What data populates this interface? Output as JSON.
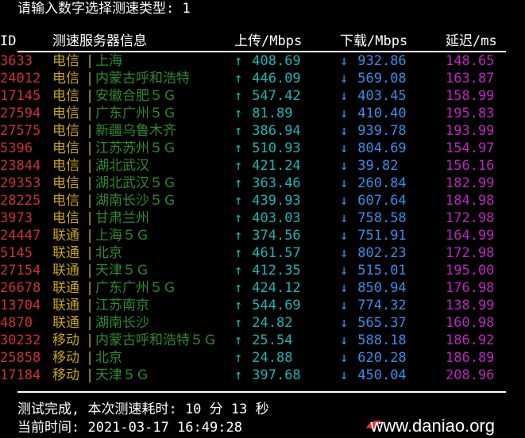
{
  "prompt": "请输入数字选择测速类型: 1",
  "header": {
    "id": "ID",
    "server": "测速服务器信息",
    "up": "上传/Mbps",
    "down": "下载/Mbps",
    "latency": "延迟/ms"
  },
  "up_arrow": "↑",
  "down_arrow": "↓",
  "bar": "|",
  "rows": [
    {
      "id": "3633",
      "isp": "电信",
      "city": "上海",
      "up": "408.69",
      "down": "932.86",
      "latency": "148.65"
    },
    {
      "id": "24012",
      "isp": "电信",
      "city": "内蒙古呼和浩特",
      "up": "446.09",
      "down": "569.08",
      "latency": "163.87"
    },
    {
      "id": "17145",
      "isp": "电信",
      "city": "安徽合肥５Ｇ",
      "up": "547.42",
      "down": "403.45",
      "latency": "158.99"
    },
    {
      "id": "27594",
      "isp": "电信",
      "city": "广东广州５Ｇ",
      "up": "81.89",
      "down": "410.40",
      "latency": "195.83"
    },
    {
      "id": "27575",
      "isp": "电信",
      "city": "新疆乌鲁木齐",
      "up": "386.94",
      "down": "939.78",
      "latency": "193.99"
    },
    {
      "id": "5396",
      "isp": "电信",
      "city": "江苏苏州５Ｇ",
      "up": "510.93",
      "down": "804.69",
      "latency": "154.97"
    },
    {
      "id": "23844",
      "isp": "电信",
      "city": "湖北武汉",
      "up": "421.24",
      "down": "39.82",
      "latency": "156.16"
    },
    {
      "id": "29353",
      "isp": "电信",
      "city": "湖北武汉５Ｇ",
      "up": "363.46",
      "down": "260.84",
      "latency": "182.99"
    },
    {
      "id": "28225",
      "isp": "电信",
      "city": "湖南长沙５Ｇ",
      "up": "439.93",
      "down": "607.64",
      "latency": "184.98"
    },
    {
      "id": "3973",
      "isp": "电信",
      "city": "甘肃兰州",
      "up": "403.03",
      "down": "758.58",
      "latency": "172.98"
    },
    {
      "id": "24447",
      "isp": "联通",
      "city": "上海５Ｇ",
      "up": "374.56",
      "down": "751.91",
      "latency": "164.99"
    },
    {
      "id": "5145",
      "isp": "联通",
      "city": "北京",
      "up": "461.57",
      "down": "802.23",
      "latency": "172.98"
    },
    {
      "id": "27154",
      "isp": "联通",
      "city": "天津５Ｇ",
      "up": "412.35",
      "down": "515.01",
      "latency": "195.00"
    },
    {
      "id": "26678",
      "isp": "联通",
      "city": "广东广州５Ｇ",
      "up": "424.12",
      "down": "850.94",
      "latency": "176.98"
    },
    {
      "id": "13704",
      "isp": "联通",
      "city": "江苏南京",
      "up": "544.69",
      "down": "774.32",
      "latency": "138.99"
    },
    {
      "id": "4870",
      "isp": "联通",
      "city": "湖南长沙",
      "up": "24.82",
      "down": "565.37",
      "latency": "160.98"
    },
    {
      "id": "30232",
      "isp": "移动",
      "city": "内蒙古呼和浩特５Ｇ",
      "up": "25.54",
      "down": "588.18",
      "latency": "186.92"
    },
    {
      "id": "25858",
      "isp": "移动",
      "city": "北京",
      "up": "24.88",
      "down": "620.28",
      "latency": "186.89"
    },
    {
      "id": "17184",
      "isp": "移动",
      "city": "天津５Ｇ",
      "up": "397.68",
      "down": "450.04",
      "latency": "208.96"
    }
  ],
  "footer": {
    "done": "测试完成, 本次测速耗时: 10 分 13 秒",
    "time": "当前时间: 2021-03-17 16:49:28"
  },
  "watermark": "www.daniao.org",
  "colors": {
    "id": "#cd3131",
    "isp": "#c7a516",
    "city": "#2e8b2e",
    "up": "#1fb3b3",
    "down": "#3b8eea",
    "latency": "#c026c0"
  }
}
